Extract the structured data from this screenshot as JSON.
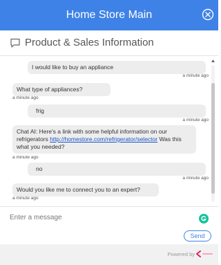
{
  "header": {
    "title": "Home Store Main",
    "close_icon": "close-circle-icon",
    "background_color": "#3f82e7"
  },
  "subheader": {
    "title": "Product & Sales Information",
    "icon": "chat-bubble-icon"
  },
  "messages": [
    {
      "sender": "user",
      "text": "I would like to buy an appliance",
      "time": "a minute ago"
    },
    {
      "sender": "bot",
      "text": "What type of appliances?",
      "time": "a minute ago"
    },
    {
      "sender": "user",
      "text": "frig",
      "time": "a minute ago"
    },
    {
      "sender": "bot",
      "text_before": "Chat AI: Here's a link with some helpful information on our refrigerators ",
      "link": "http://homestore.com/refrigerator/selector",
      "text_after": " Was this what you needed?",
      "time": "a minute ago"
    },
    {
      "sender": "user",
      "text": "no",
      "time": "a minute ago"
    },
    {
      "sender": "bot",
      "text": "Would you like me to connect you to an expert?",
      "time": "a minute ago"
    }
  ],
  "composer": {
    "placeholder": "Enter a message",
    "send_label": "Send"
  },
  "footer": {
    "powered_by": "Powered by",
    "logo_icon": "brand-logo-icon"
  }
}
